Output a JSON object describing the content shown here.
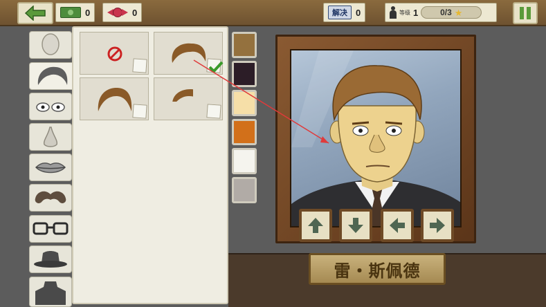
{
  "topbar": {
    "cash_count": "0",
    "candy_count": "0",
    "stamp_label": "解决",
    "stamp_count": "0",
    "level_label": "等级",
    "level_value": "1",
    "progress_text": "0/3"
  },
  "categories": [
    "face-shape",
    "hair",
    "eyes",
    "nose",
    "mouth",
    "mustache",
    "glasses",
    "hat",
    "clothes"
  ],
  "selected_category": "hair",
  "hair_options": [
    {
      "name": "none",
      "selected": false
    },
    {
      "name": "hair-1",
      "selected": true
    },
    {
      "name": "hair-2",
      "selected": false
    },
    {
      "name": "hair-3",
      "selected": false
    }
  ],
  "colors": [
    "#94713e",
    "#2c1d27",
    "#f6dfa8",
    "#d2701a",
    "#f5f4ee",
    "#b1aba6"
  ],
  "portrait": {
    "nameplate": "雷・斯佩德"
  },
  "controls": [
    "up",
    "down",
    "left",
    "right"
  ]
}
